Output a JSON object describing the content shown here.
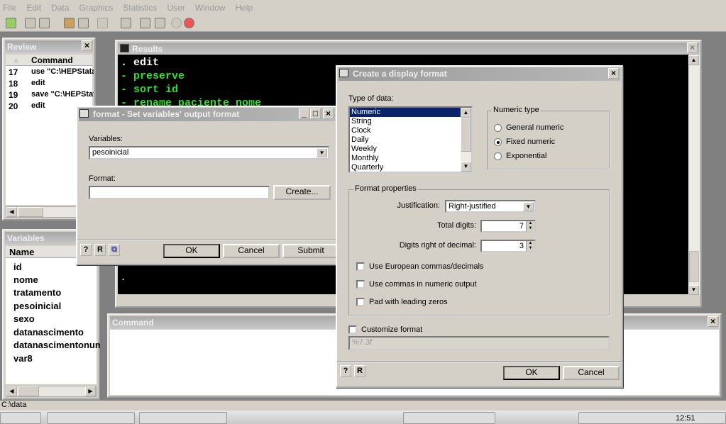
{
  "menu": [
    "File",
    "Edit",
    "Data",
    "Graphics",
    "Statistics",
    "User",
    "Window",
    "Help"
  ],
  "review": {
    "title": "Review",
    "col_sort": "▵",
    "col_command": "Command",
    "rows": [
      {
        "n": "17",
        "cmd": "use \"C:\\HEPStata\\"
      },
      {
        "n": "18",
        "cmd": "edit"
      },
      {
        "n": "19",
        "cmd": "save \"C:\\HEPStata"
      },
      {
        "n": "20",
        "cmd": "edit"
      }
    ]
  },
  "variables": {
    "title": "Variables",
    "col_name": "Name",
    "items": [
      "id",
      "nome",
      "tratamento",
      "pesoinicial",
      "sexo",
      "datanascimento",
      "datanascimentonum",
      "var8"
    ]
  },
  "results": {
    "title": "Results",
    "lines": [
      ". edit",
      "- preserve",
      "- sort id",
      "- rename paciente nome"
    ],
    "prompt": "."
  },
  "command": {
    "title": "Command",
    "value": ""
  },
  "format_dialog": {
    "title": "format - Set variables' output format",
    "variables_label": "Variables:",
    "variables_value": "pesoinicial",
    "format_label": "Format:",
    "format_value": "",
    "create_label": "Create...",
    "ok": "OK",
    "cancel": "Cancel",
    "submit": "Submit"
  },
  "create_dialog": {
    "title": "Create a display format",
    "type_label": "Type of data:",
    "types": [
      "Numeric",
      "String",
      "Clock",
      "Daily",
      "Weekly",
      "Monthly",
      "Quarterly"
    ],
    "selected_type": "Numeric",
    "numeric_type": {
      "label": "Numeric type",
      "options": [
        "General numeric",
        "Fixed numeric",
        "Exponential"
      ],
      "selected": "Fixed numeric"
    },
    "props": {
      "label": "Format properties",
      "justification_label": "Justification:",
      "justification": "Right-justified",
      "total_digits_label": "Total digits:",
      "total_digits": "7",
      "decimal_label": "Digits right of decimal:",
      "decimal": "3",
      "checks": [
        {
          "label": "Use European commas/decimals",
          "checked": false
        },
        {
          "label": "Use commas in numeric output",
          "checked": false
        },
        {
          "label": "Pad with leading zeros",
          "checked": false
        }
      ]
    },
    "customize_label": "Customize format",
    "customize_checked": false,
    "format_preview": "%7.3f",
    "ok": "OK",
    "cancel": "Cancel"
  },
  "status": {
    "path": "C:\\data"
  },
  "taskbar": {
    "clock": "12:51"
  },
  "colors": {
    "results_bg": "#000000",
    "results_green": "#2ee02e",
    "selection": "#0a246a",
    "chrome": "#d4d0c8"
  }
}
